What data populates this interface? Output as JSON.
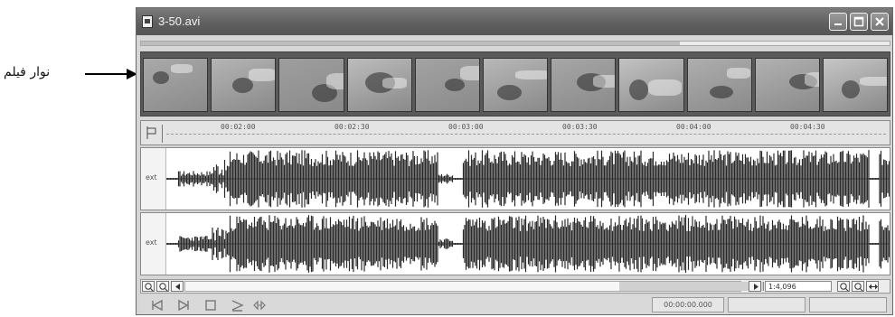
{
  "annotation": {
    "label": "نوار فیلم",
    "arrow_icon": "arrow-right-icon"
  },
  "window": {
    "title": "3-50.avi",
    "controls": [
      "minimize-icon",
      "maximize-icon",
      "close-icon"
    ]
  },
  "load_progress": 0.72,
  "filmstrip": {
    "frame_count": 11
  },
  "ruler": {
    "tick_labels": [
      "00:02:00",
      "00:02:30",
      "00:03:00",
      "00:03:30",
      "00:04:00",
      "00:04:30"
    ]
  },
  "tracks": [
    {
      "label": "ext"
    },
    {
      "label": "ext"
    }
  ],
  "scroll": {
    "zoom_ratio": "1:4,096"
  },
  "transport": {
    "buttons": [
      "go-to-start-icon",
      "go-to-end-icon",
      "stop-icon",
      "play-icon",
      "loop-play-icon"
    ],
    "position": "00:00:00.000"
  },
  "colors": {
    "titlebar": "#5e5e5e",
    "window_bg": "#d6d6d6",
    "waveform": "#2a2a2a"
  }
}
